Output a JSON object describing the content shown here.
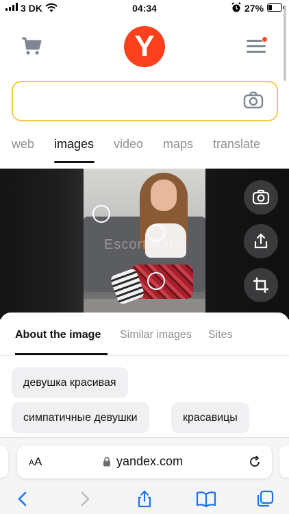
{
  "status_bar": {
    "carrier": "3 DK",
    "time": "04:34",
    "battery": "27%"
  },
  "header": {
    "logo_letter": "Y"
  },
  "search": {
    "value": ""
  },
  "tabs": [
    {
      "label": "web",
      "active": false
    },
    {
      "label": "images",
      "active": true
    },
    {
      "label": "video",
      "active": false
    },
    {
      "label": "maps",
      "active": false
    },
    {
      "label": "translate",
      "active": false
    }
  ],
  "image_viewer": {
    "watermark": "Escort Babe"
  },
  "sheet": {
    "tabs": [
      {
        "label": "About the image",
        "active": true
      },
      {
        "label": "Similar images",
        "active": false
      },
      {
        "label": "Sites",
        "active": false
      }
    ],
    "chips": [
      "девушка красивая",
      "симпатичные девушки",
      "красавицы"
    ]
  },
  "safari": {
    "aa_label": "AA",
    "url": "yandex.com"
  },
  "colors": {
    "brand_red": "#fc3f1d",
    "search_border": "#f2c94c",
    "ios_blue": "#1a73e8"
  }
}
